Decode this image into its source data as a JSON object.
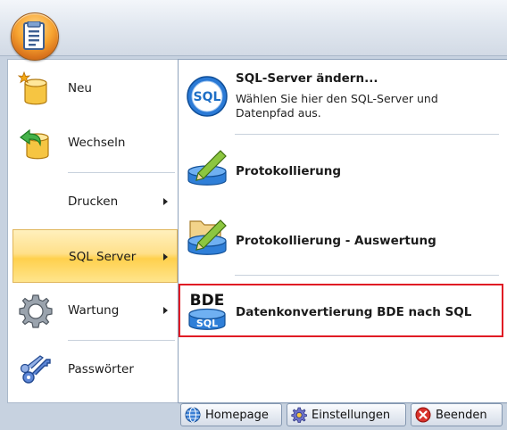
{
  "left_menu": {
    "items": [
      {
        "label": "Neu",
        "icon": "new-document-icon"
      },
      {
        "label": "Wechseln",
        "icon": "switch-database-icon"
      },
      {
        "label": "Drucken",
        "icon": "none"
      },
      {
        "label": "SQL Server",
        "icon": "none"
      },
      {
        "label": "Wartung",
        "icon": "gear-icon"
      },
      {
        "label": "Passwörter",
        "icon": "keys-icon"
      }
    ]
  },
  "right_menu": {
    "items": [
      {
        "title": "SQL-Server ändern...",
        "description": "Wählen Sie hier den SQL-Server und Datenpfad aus.",
        "icon": "sql-icon"
      },
      {
        "title": "Protokollierung",
        "icon": "database-pencil-icon"
      },
      {
        "title": "Protokollierung - Auswertung",
        "icon": "database-folder-pencil-icon"
      },
      {
        "title": "Datenkonvertierung BDE nach SQL",
        "icon": "bde-sql-icon",
        "icon_text_top": "BDE",
        "icon_text_bottom": "SQL"
      }
    ]
  },
  "footer": {
    "homepage": "Homepage",
    "settings": "Einstellungen",
    "exit": "Beenden"
  },
  "colors": {
    "selection": "#ffd04d",
    "highlight_border": "#e01b24",
    "sql_blue": "#1f6fc6"
  }
}
